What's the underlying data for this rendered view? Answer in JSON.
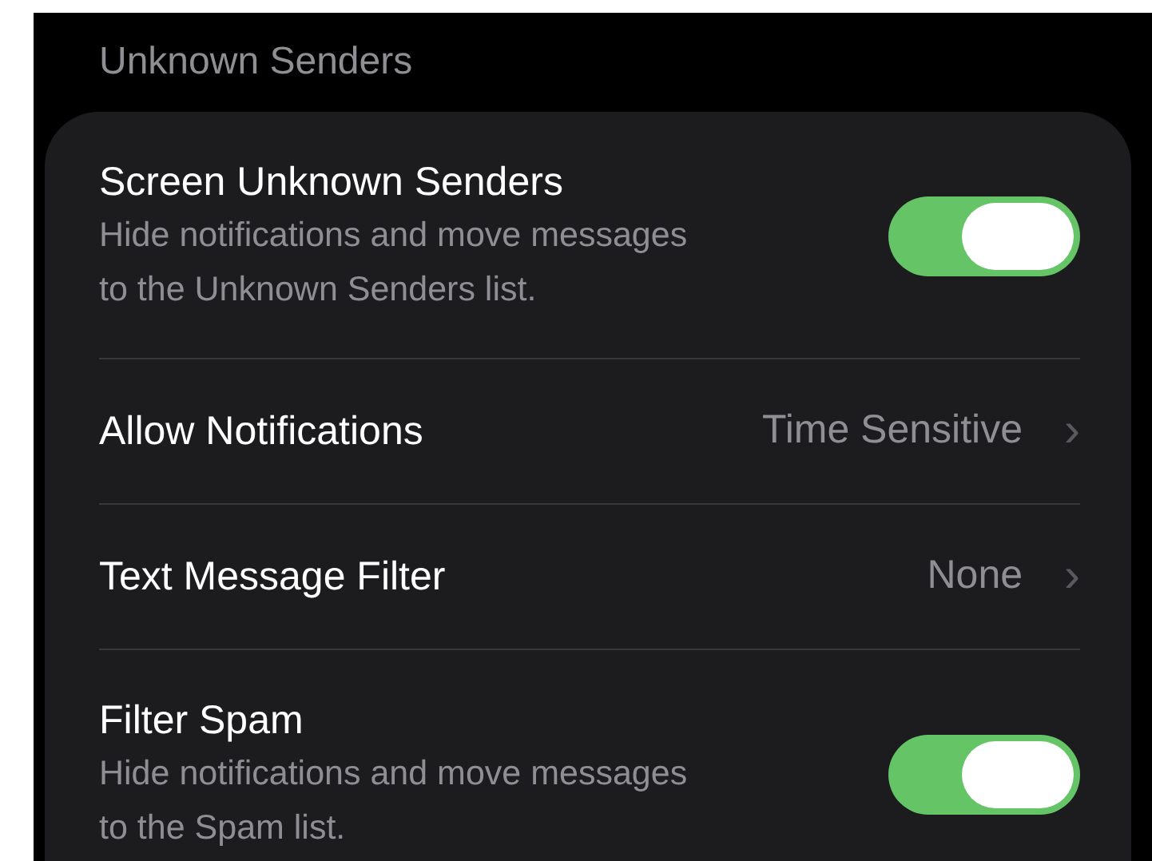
{
  "section_header": "Unknown Senders",
  "rows": [
    {
      "kind": "toggle",
      "title": "Screen Unknown Senders",
      "subtitle_lines": [
        "Hide notifications and move messages",
        "to the Unknown Senders list."
      ],
      "on": true
    },
    {
      "kind": "link",
      "title": "Allow Notifications",
      "value": "Time Sensitive",
      "chevron": "›"
    },
    {
      "kind": "link",
      "title": "Text Message Filter",
      "value": "None",
      "chevron": "›"
    },
    {
      "kind": "toggle",
      "title": "Filter Spam",
      "subtitle_lines": [
        "Hide notifications and move messages",
        "to the Spam list."
      ],
      "on": true
    }
  ]
}
